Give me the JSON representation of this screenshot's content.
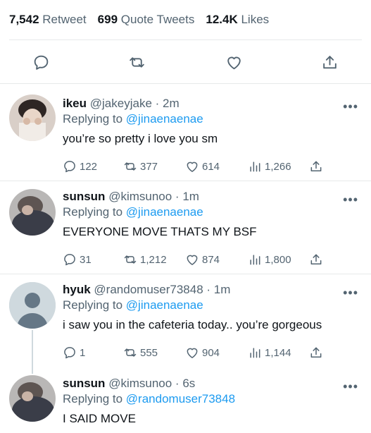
{
  "stats": [
    {
      "num": "7,542",
      "label": "Retweet"
    },
    {
      "num": "699",
      "label": "Quote Tweets"
    },
    {
      "num": "12.4K",
      "label": "Likes"
    }
  ],
  "colors": {
    "text": "#0f1419",
    "muted": "#536471",
    "link": "#1d9bf0",
    "divider": "#e7e9ea"
  },
  "tweets": [
    {
      "name": "ikeu",
      "handle": "@jakeyjake",
      "time": "2m",
      "reply_prefix": "Replying to",
      "reply_to": "@jinaenaenae",
      "text": "you’re so pretty i love you sm",
      "replies": "122",
      "retweets": "377",
      "likes": "614",
      "views": "1,266"
    },
    {
      "name": "sunsun",
      "handle": "@kimsunoo",
      "time": "1m",
      "reply_prefix": "Replying to",
      "reply_to": "@jinaenaenae",
      "text": "EVERYONE MOVE THATS MY BSF",
      "replies": "31",
      "retweets": "1,212",
      "likes": "874",
      "views": "1,800"
    },
    {
      "name": "hyuk",
      "handle": "@randomuser73848",
      "time": "1m",
      "reply_prefix": "Replying to",
      "reply_to": "@jinaenaenae",
      "text": "i saw you in the cafeteria today.. you’re gorgeous",
      "replies": "1",
      "retweets": "555",
      "likes": "904",
      "views": "1,144"
    },
    {
      "name": "sunsun",
      "handle": "@kimsunoo",
      "time": "6s",
      "reply_prefix": "Replying to",
      "reply_to": "@randomuser73848",
      "text": "I SAID MOVE"
    }
  ]
}
